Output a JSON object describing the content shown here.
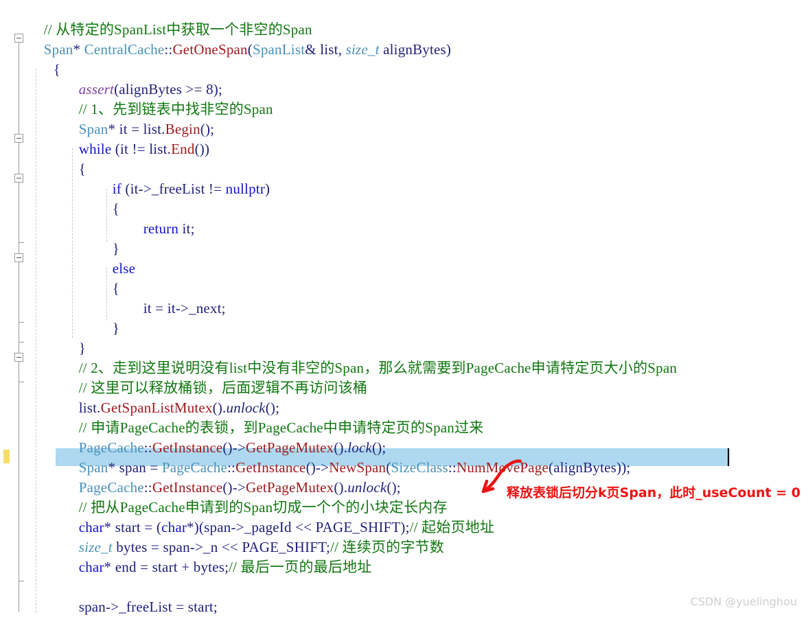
{
  "editor": {
    "kind": "visual-studio-code-editor",
    "colors": {
      "background": "#ffffff",
      "comment": "#127712",
      "keyword": "#1414cf",
      "type": "#4a90b8",
      "function": "#a01b20",
      "identifier": "#1f1f7a",
      "macro": "#7a3fa0",
      "selection": "#add8f0",
      "change_bar": "#f5de6a",
      "annotation": "#ee1111",
      "watermark": "#cfcfcf",
      "fold_margin": "#9a9a9a",
      "indent_guide": "#c8c8c8"
    },
    "caret_visible": true
  },
  "code_lines": [
    {
      "indent": 1,
      "text": "// 从特定的SpanList中获取一个非空的Span"
    },
    {
      "indent": 0,
      "text": "Span* CentralCache::GetOneSpan(SpanList& list, size_t alignBytes)"
    },
    {
      "indent": 0,
      "text": "{"
    },
    {
      "indent": 1,
      "text": "assert(alignBytes >= 8);"
    },
    {
      "indent": 1,
      "text": "// 1、先到链表中找非空的Span"
    },
    {
      "indent": 1,
      "text": "Span* it = list.Begin();"
    },
    {
      "indent": 1,
      "text": "while (it != list.End())"
    },
    {
      "indent": 1,
      "text": "{"
    },
    {
      "indent": 2,
      "text": "if (it->_freeList != nullptr)"
    },
    {
      "indent": 2,
      "text": "{"
    },
    {
      "indent": 3,
      "text": "return it;"
    },
    {
      "indent": 2,
      "text": "}"
    },
    {
      "indent": 2,
      "text": "else"
    },
    {
      "indent": 2,
      "text": "{"
    },
    {
      "indent": 3,
      "text": "it = it->_next;"
    },
    {
      "indent": 2,
      "text": "}"
    },
    {
      "indent": 1,
      "text": "}"
    },
    {
      "indent": 1,
      "text": "// 2、走到这里说明没有list中没有非空的Span，那么就需要到PageCache申请特定页大小的Span"
    },
    {
      "indent": 1,
      "text": "// 这里可以释放桶锁，后面逻辑不再访问该桶"
    },
    {
      "indent": 1,
      "text": "list.GetSpanListMutex().unlock();"
    },
    {
      "indent": 1,
      "text": "// 申请PageCache的表锁，到PageCache中申请特定页的Span过来"
    },
    {
      "indent": 1,
      "text": "PageCache::GetInstance()->GetPageMutex().lock();"
    },
    {
      "indent": 1,
      "text": "Span* span = PageCache::GetInstance()->NewSpan(SizeClass::NumMovePage(alignBytes));"
    },
    {
      "indent": 1,
      "text": "PageCache::GetInstance()->GetPageMutex().unlock();"
    },
    {
      "indent": 1,
      "text": "// 把从PageCache申请到的Span切成一个个的小块定长内存"
    },
    {
      "indent": 1,
      "text": "char* start = (char*)(span->_pageId << PAGE_SHIFT);// 起始页地址"
    },
    {
      "indent": 1,
      "text": "size_t bytes = span->_n << PAGE_SHIFT;// 连续页的字节数"
    },
    {
      "indent": 1,
      "text": "char* end = start + bytes;// 最后一页的最后地址"
    },
    {
      "indent": 1,
      "text": ""
    },
    {
      "indent": 1,
      "text": "span->_freeList = start;"
    }
  ],
  "tokens": {
    "l1_comment": "// 从特定的SpanList中获取一个非空的Span",
    "l2_span": "Span",
    "l2_star_sp": "* ",
    "l2_central": "CentralCache",
    "l2_colons": "::",
    "l2_getonespan": "GetOneSpan",
    "l2_paren_open": "(",
    "l2_spanlist": "SpanList",
    "l2_amp_list": "& list, ",
    "l2_sizet": "size_t",
    "l2_alignbytes": " alignBytes)",
    "l3_brace": "{",
    "l4_assert": "assert",
    "l4_rest": "(alignBytes >= 8);",
    "l5_comment": "// 1、先到链表中找非空的Span",
    "l6_span": "Span",
    "l6_mid": "* it = list.",
    "l6_begin": "Begin",
    "l6_end": "();",
    "l7_while": "while",
    "l7_mid": " (it != list.",
    "l7_end_fn": "End",
    "l7_tail": "())",
    "l8_brace": "{",
    "l9_if": "if",
    "l9_mid": " (it->_freeList != ",
    "l9_nullptr": "nullptr",
    "l9_tail": ")",
    "l10_brace": "{",
    "l11_return": "return",
    "l11_it": " it;",
    "l12_brace": "}",
    "l13_else": "else",
    "l14_brace": "{",
    "l15_text": "it = it->_next;",
    "l16_brace": "}",
    "l17_brace": "}",
    "l18_comment": "// 2、走到这里说明没有list中没有非空的Span，那么就需要到PageCache申请特定页大小的Span",
    "l19_comment": "// 这里可以释放桶锁，后面逻辑不再访问该桶",
    "l20_list": "list.",
    "l20_fn": "GetSpanListMutex",
    "l20_dot": "().",
    "l20_unlock": "unlock",
    "l20_tail": "();",
    "l21_comment": "// 申请PageCache的表锁，到PageCache中申请特定页的Span过来",
    "l22_pagecache": "PageCache",
    "l22_colons": "::",
    "l22_getinstance": "GetInstance",
    "l22_arrow": "()->",
    "l22_getpagemutex": "GetPageMutex",
    "l22_dot": "().",
    "l22_lock": "lock",
    "l22_tail": "();",
    "l23_span": "Span",
    "l23_varspan": "* span = ",
    "l23_pagecache": "PageCache",
    "l23_colons": "::",
    "l23_getinstance": "GetInstance",
    "l23_arrow": "()->",
    "l23_newspan": "NewSpan",
    "l23_open": "(",
    "l23_sizeclass": "SizeClass",
    "l23_colons2": "::",
    "l23_nummovepage": "NumMovePage",
    "l23_tail": "(alignBytes));",
    "l24_pagecache": "PageCache",
    "l24_colons": "::",
    "l24_getinstance": "GetInstance",
    "l24_arrow": "()->",
    "l24_getpagemutex": "GetPageMutex",
    "l24_dot": "().",
    "l24_unlock": "unlock",
    "l24_tail": "();",
    "l25_comment": "// 把从PageCache申请到的Span切成一个个的小块定长内存",
    "l26_char": "char",
    "l26_mid": "* start = (",
    "l26_char2": "char",
    "l26_mid2": "*)(span->_pageId << PAGE_SHIFT);",
    "l26_comment": "// 起始页地址",
    "l27_sizet": "size_t",
    "l27_mid": " bytes = span->_n << PAGE_SHIFT;",
    "l27_comment": "// 连续页的字节数",
    "l28_char": "char",
    "l28_mid": "* end = start + bytes;",
    "l28_comment": "// 最后一页的最后地址",
    "l30_text": "span->_freeList = start;"
  },
  "annotation": {
    "text": "释放表锁后切分k页Span，此时_useCount = 0",
    "arrow": "curved-arrow-down-left"
  },
  "watermark": {
    "text": "CSDN @yuelinghou"
  }
}
